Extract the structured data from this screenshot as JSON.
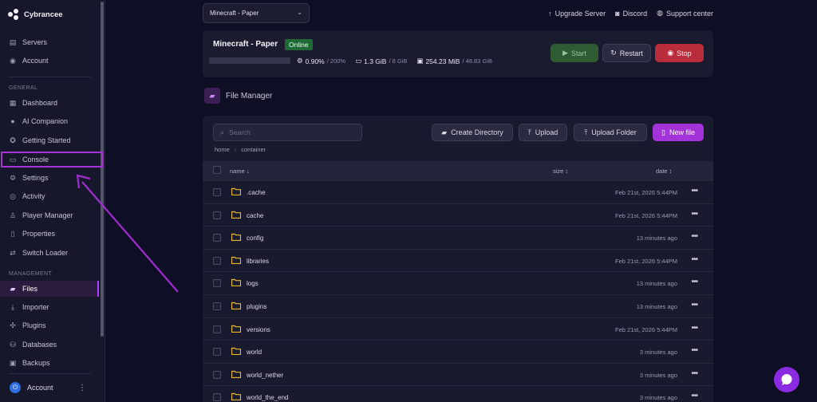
{
  "brand": {
    "name": "Cybrancee"
  },
  "sidebar": {
    "top_items": [
      {
        "label": "Servers",
        "icon": "server-icon"
      },
      {
        "label": "Account",
        "icon": "account-icon"
      }
    ],
    "general_label": "GENERAL",
    "general_items": [
      {
        "label": "Dashboard",
        "icon": "dashboard-icon"
      },
      {
        "label": "AI Companion",
        "icon": "chat-icon"
      },
      {
        "label": "Getting Started",
        "icon": "rocket-icon"
      },
      {
        "label": "Console",
        "icon": "terminal-icon"
      },
      {
        "label": "Settings",
        "icon": "gear-icon"
      },
      {
        "label": "Activity",
        "icon": "eye-icon"
      },
      {
        "label": "Player Manager",
        "icon": "person-icon"
      },
      {
        "label": "Properties",
        "icon": "file-icon"
      },
      {
        "label": "Switch Loader",
        "icon": "switch-icon"
      }
    ],
    "management_label": "MANAGEMENT",
    "management_items": [
      {
        "label": "Files",
        "icon": "folder-icon",
        "active": true
      },
      {
        "label": "Importer",
        "icon": "download-icon"
      },
      {
        "label": "Plugins",
        "icon": "puzzle-icon"
      },
      {
        "label": "Databases",
        "icon": "database-icon"
      },
      {
        "label": "Backups",
        "icon": "archive-icon"
      }
    ],
    "account_label": "Account"
  },
  "topbar": {
    "server_select": "Minecraft - Paper",
    "links": [
      "Upgrade Server",
      "Discord",
      "Support center"
    ]
  },
  "server": {
    "name": "Minecraft - Paper",
    "status": "Online",
    "cpu": "0.90%",
    "cpu_limit": "/ 200%",
    "memory": "1.3 GiB",
    "memory_limit": "/ 8 GiB",
    "disk": "254.23 MiB",
    "disk_limit": "/ 48.83 GiB",
    "start_label": "Start",
    "restart_label": "Restart",
    "stop_label": "Stop"
  },
  "file_manager": {
    "title": "File Manager",
    "search_placeholder": "Search",
    "buttons": {
      "create_directory": "Create Directory",
      "upload": "Upload",
      "upload_folder": "Upload Folder",
      "new_file": "New file"
    },
    "breadcrumb": [
      "home",
      "container"
    ],
    "columns": {
      "name": "name ↓",
      "size": "size ↕",
      "date": "date ↕"
    },
    "rows": [
      {
        "name": ".cache",
        "date": "Feb 21st, 2026 5:44PM"
      },
      {
        "name": "cache",
        "date": "Feb 21st, 2026 5:44PM"
      },
      {
        "name": "config",
        "date": "13 minutes ago"
      },
      {
        "name": "libraries",
        "date": "Feb 21st, 2026 5:44PM"
      },
      {
        "name": "logs",
        "date": "13 minutes ago"
      },
      {
        "name": "plugins",
        "date": "13 minutes ago"
      },
      {
        "name": "versions",
        "date": "Feb 21st, 2026 5:44PM"
      },
      {
        "name": "world",
        "date": "3 minutes ago"
      },
      {
        "name": "world_nether",
        "date": "3 minutes ago"
      },
      {
        "name": "world_the_end",
        "date": "3 minutes ago"
      }
    ]
  },
  "colors": {
    "accent": "#a332d8",
    "online": "#1f6a34",
    "stop": "#b82c3b",
    "folder": "#e8b923"
  }
}
